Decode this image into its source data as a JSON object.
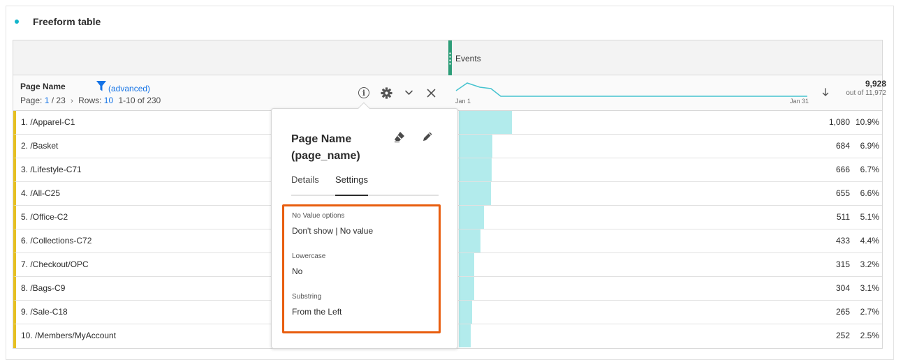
{
  "panel": {
    "title": "Freeform table"
  },
  "metric": {
    "name": "Events"
  },
  "dimension": {
    "title": "Page Name",
    "filter_label": "(advanced)",
    "pager": {
      "page_label": "Page:",
      "page_current": "1",
      "page_total": "/ 23",
      "rows_label": "Rows:",
      "rows_value": "10",
      "range": "1-10 of 230"
    }
  },
  "sparkline": {
    "start_label": "Jan 1",
    "end_label": "Jan 31"
  },
  "totals": {
    "value": "9,928",
    "sub": "out of 11,972"
  },
  "rows": [
    {
      "label": "1.  /Apparel-C1",
      "value": "1,080",
      "pct": "10.9%",
      "fraction": 0.109
    },
    {
      "label": "2.  /Basket",
      "value": "684",
      "pct": "6.9%",
      "fraction": 0.069
    },
    {
      "label": "3.  /Lifestyle-C71",
      "value": "666",
      "pct": "6.7%",
      "fraction": 0.067
    },
    {
      "label": "4.  /All-C25",
      "value": "655",
      "pct": "6.6%",
      "fraction": 0.066
    },
    {
      "label": "5.  /Office-C2",
      "value": "511",
      "pct": "5.1%",
      "fraction": 0.051
    },
    {
      "label": "6.  /Collections-C72",
      "value": "433",
      "pct": "4.4%",
      "fraction": 0.044
    },
    {
      "label": "7.  /Checkout/OPC",
      "value": "315",
      "pct": "3.2%",
      "fraction": 0.032
    },
    {
      "label": "8.  /Bags-C9",
      "value": "304",
      "pct": "3.1%",
      "fraction": 0.031
    },
    {
      "label": "9.  /Sale-C18",
      "value": "265",
      "pct": "2.7%",
      "fraction": 0.027
    },
    {
      "label": "10.  /Members/MyAccount",
      "value": "252",
      "pct": "2.5%",
      "fraction": 0.025
    }
  ],
  "popover": {
    "title": "Page Name (page_name)",
    "tabs": {
      "details": "Details",
      "settings": "Settings"
    },
    "settings": {
      "no_value_label": "No Value options",
      "no_value_value": "Don't show | No value",
      "lowercase_label": "Lowercase",
      "lowercase_value": "No",
      "substring_label": "Substring",
      "substring_value": "From the Left"
    }
  },
  "colors": {
    "accent_blue": "#1473e6",
    "metric_bar": "#2d9d78",
    "row_marker": "#e6c022",
    "bar_fill": "#b2ebec",
    "highlight_box": "#e85d0e",
    "panel_dot": "#12b5cb"
  },
  "icons": [
    "filter-icon",
    "info-icon",
    "gear-icon",
    "chevron-down-icon",
    "close-icon",
    "sort-down-icon",
    "eraser-icon",
    "pencil-icon"
  ]
}
